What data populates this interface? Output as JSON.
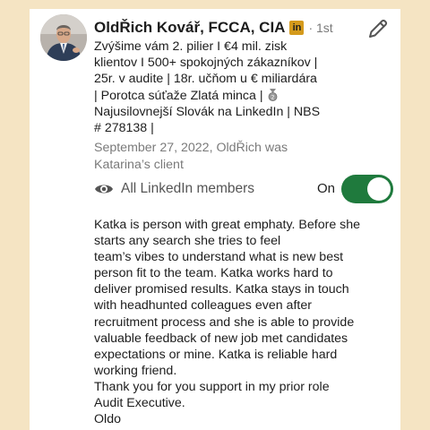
{
  "profile": {
    "name": "OldŘich Kovář, FCCA, CIA",
    "linkedin_badge": "in",
    "degree": "· 1st",
    "headline_lines": [
      "Zvýšime vám 2. pilier I €4 mil. zisk",
      "klientov I 500+ spokojných zákazníkov |",
      "25r. v audite |  18r. učňom u € miliardára",
      "|  Porotca súťaže Zlatá minca |",
      "Najusilovnejší Slovák na LinkedIn | NBS",
      "# 278138 |"
    ],
    "relationship_lines": [
      "September 27, 2022, OldŘich was",
      "Katarina’s client"
    ]
  },
  "icons": {
    "edit": "pencil-edit-icon",
    "visibility": "eye-icon",
    "medal": "medal-icon"
  },
  "visibility": {
    "label": "All LinkedIn members",
    "state_label": "On",
    "enabled": true
  },
  "recommendation": {
    "lines": [
      "Katka is person with great emphaty. Before she",
      "starts any search she tries to feel",
      "team’s vibes to understand what is new best",
      "person fit to the team. Katka works hard to",
      "deliver promised results. Katka stays in touch",
      "with headhunted colleagues even after",
      "recruitment process and she is able to provide",
      "valuable feedback of new job met candidates",
      "expectations or mine. Katka is reliable hard",
      "working friend.",
      "Thank you for you support in my prior role",
      "Audit Executive.",
      "Oldo"
    ]
  },
  "colors": {
    "background": "#f5e4c3",
    "card": "#ffffff",
    "toggle_on": "#1f7a3d",
    "muted_text": "#7a7a7a",
    "badge": "#d49a1c"
  }
}
